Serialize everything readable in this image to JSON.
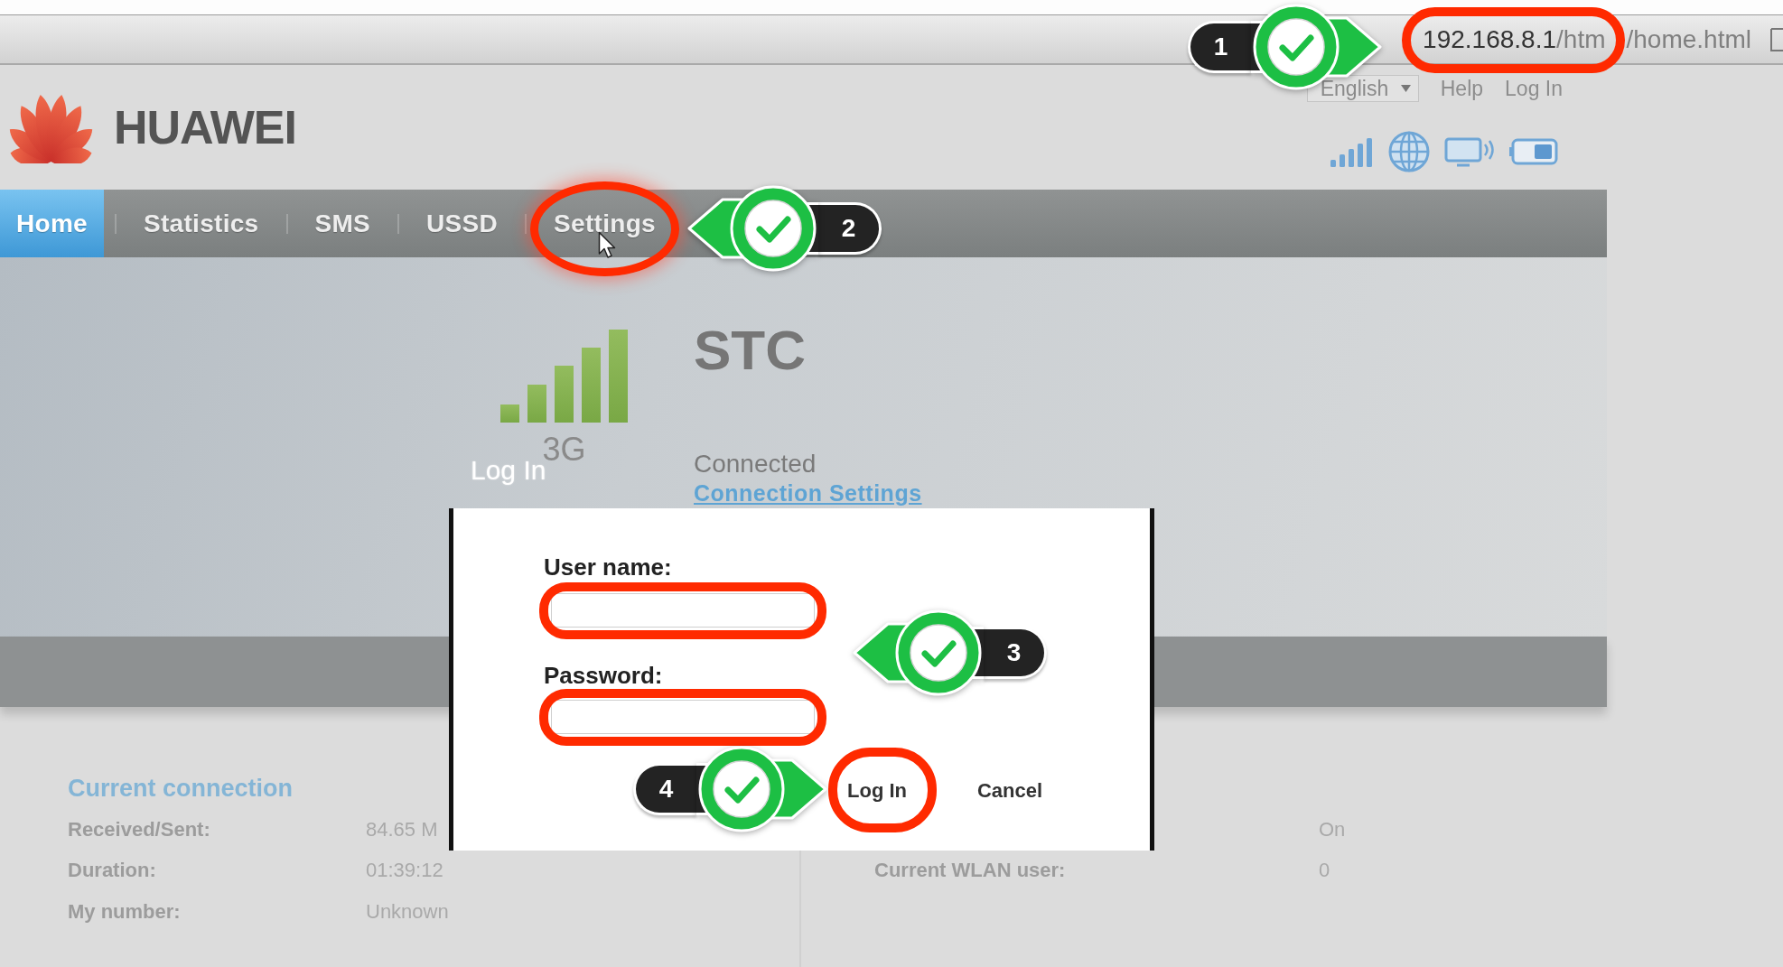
{
  "browser": {
    "url": {
      "host": "192.168.8.1",
      "path": "/htm",
      "highlighted": true
    },
    "url_rest": "/home.html"
  },
  "header": {
    "brand": "HUAWEI",
    "language": "English",
    "links": [
      "Help",
      "Log In"
    ]
  },
  "nav": {
    "tabs": [
      {
        "label": "Home",
        "selected": true,
        "highlighted": false
      },
      {
        "label": "Statistics",
        "selected": false,
        "highlighted": false
      },
      {
        "label": "SMS",
        "selected": false,
        "highlighted": false
      },
      {
        "label": "USSD",
        "selected": false,
        "highlighted": false
      },
      {
        "label": "Settings",
        "selected": false,
        "highlighted": true
      }
    ]
  },
  "network": {
    "type": "3G",
    "operator": "STC",
    "state": "Connected",
    "settings_link": "Connection Settings"
  },
  "login_dialog": {
    "title": "Log In",
    "fields": [
      {
        "label": "User name:",
        "highlighted": true
      },
      {
        "label": "Password:",
        "highlighted": true
      }
    ],
    "buttons": [
      {
        "label": "Log In",
        "highlighted": true
      },
      {
        "label": "Cancel",
        "highlighted": false
      }
    ]
  },
  "current_connection": {
    "title": "Current connection",
    "rows": [
      {
        "label": "Received/Sent:",
        "value": "84.65 M"
      },
      {
        "label": "Duration:",
        "value": "01:39:12"
      },
      {
        "label": "My number:",
        "value": "Unknown"
      }
    ]
  },
  "wlan": {
    "rows": [
      {
        "value": "On"
      },
      {
        "label": "Current WLAN user:",
        "value": "0"
      }
    ]
  },
  "steps": [
    {
      "number": "1",
      "kind": "rightward"
    },
    {
      "number": "2",
      "kind": "leftward"
    },
    {
      "number": "3",
      "kind": "leftward"
    },
    {
      "number": "4",
      "kind": "rightward"
    }
  ]
}
